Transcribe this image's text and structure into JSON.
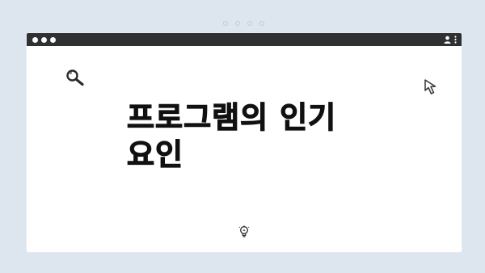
{
  "page": {
    "title_line1": "프로그램의 인기",
    "title_line2": "요인"
  },
  "icons": {
    "search": "search-icon",
    "cursor": "cursor-arrow-icon",
    "lightbulb": "lightbulb-icon",
    "user": "user-icon",
    "menu": "kebab-menu-icon"
  },
  "colors": {
    "background": "#dde6ef",
    "titlebar": "#2f3032",
    "window": "#ffffff",
    "title_text": "#111111"
  }
}
